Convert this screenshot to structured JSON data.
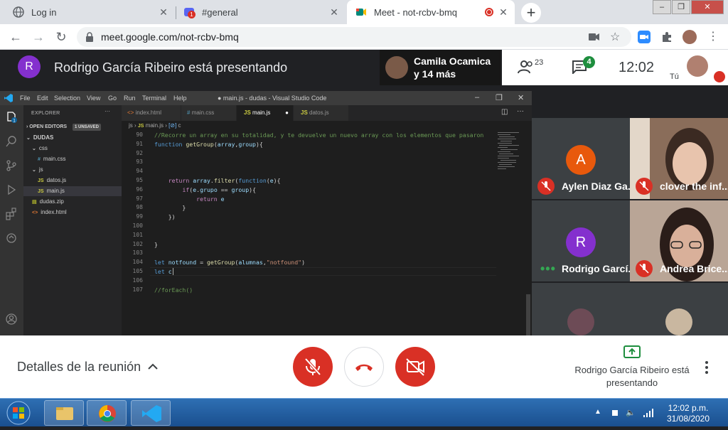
{
  "browser": {
    "tabs": [
      {
        "title": "Log in",
        "icon": "globe-icon"
      },
      {
        "title": "#general",
        "icon": "discord-icon",
        "badge": "1"
      },
      {
        "title": "Meet - not-rcbv-bmq",
        "icon": "meet-icon",
        "recording": true
      }
    ],
    "url": "meet.google.com/not-rcbv-bmq"
  },
  "meet": {
    "presenter_initial": "R",
    "presenting_text": "Rodrigo García Ribeiro está presentando",
    "speaker_name": "Camila Ocamica",
    "speaker_more": "y 14 más",
    "people_count": "23",
    "chat_badge": "4",
    "clock": "12:02",
    "self_label": "Tú",
    "colors": {
      "accent_red": "#d93025",
      "green": "#1e8e3e",
      "dark": "#202124"
    }
  },
  "vscode": {
    "menu": [
      "File",
      "Edit",
      "Selection",
      "View",
      "Go",
      "Run",
      "Terminal",
      "Help"
    ],
    "window_title": "● main.js - dudas - Visual Studio Code",
    "explorer_label": "EXPLORER",
    "open_editors_label": "OPEN EDITORS",
    "unsaved_label": "1 UNSAVED",
    "tree": [
      {
        "label": "DUDAS",
        "indent": 0,
        "type": "folder-open"
      },
      {
        "label": "css",
        "indent": 1,
        "type": "folder-open"
      },
      {
        "label": "main.css",
        "indent": 2,
        "type": "css"
      },
      {
        "label": "js",
        "indent": 1,
        "type": "folder-open"
      },
      {
        "label": "datos.js",
        "indent": 2,
        "type": "js"
      },
      {
        "label": "main.js",
        "indent": 2,
        "type": "js",
        "selected": true
      },
      {
        "label": "dudas.zip",
        "indent": 1,
        "type": "zip"
      },
      {
        "label": "index.html",
        "indent": 1,
        "type": "html"
      }
    ],
    "tabs": [
      {
        "label": "index.html",
        "icon": "<>"
      },
      {
        "label": "main.css",
        "icon": "#"
      },
      {
        "label": "main.js",
        "icon": "JS",
        "active": true,
        "dirty": true
      },
      {
        "label": "datos.js",
        "icon": "JS"
      }
    ],
    "breadcrumb": [
      "js",
      "main.js",
      "c"
    ],
    "lines": [
      {
        "n": "90",
        "text": "//Recorre un array en su totalidad, y te devuelve un nuevo array con los elementos que pasaron"
      },
      {
        "n": "91",
        "text": "function getGroup(array,group){"
      },
      {
        "n": "92",
        "text": ""
      },
      {
        "n": "93",
        "text": ""
      },
      {
        "n": "94",
        "text": ""
      },
      {
        "n": "95",
        "text": "    return array.filter(function(e){"
      },
      {
        "n": "96",
        "text": "        if(e.grupo == group){"
      },
      {
        "n": "97",
        "text": "            return e"
      },
      {
        "n": "98",
        "text": "        }"
      },
      {
        "n": "99",
        "text": "    })"
      },
      {
        "n": "100",
        "text": ""
      },
      {
        "n": "101",
        "text": ""
      },
      {
        "n": "102",
        "text": "}"
      },
      {
        "n": "103",
        "text": ""
      },
      {
        "n": "104",
        "text": "let notfound = getGroup(alumnas,\"notfound\")"
      },
      {
        "n": "105",
        "text": "let c"
      },
      {
        "n": "106",
        "text": ""
      },
      {
        "n": "107",
        "text": "//forEach()"
      }
    ]
  },
  "participants": [
    {
      "name": "Aylen Diaz Ga...",
      "initial": "A",
      "color": "#e8590c",
      "muted": true
    },
    {
      "name": "clover the inf...",
      "video": true,
      "muted": true
    },
    {
      "name": "Rodrigo Garcí...",
      "initial": "R",
      "color": "#8430ce",
      "speaking": true
    },
    {
      "name": "Andrea Brice...",
      "video": true,
      "muted": true
    }
  ],
  "controls": {
    "details_label": "Detalles de la reunión",
    "presenting_label": "Rodrigo García Ribeiro está presentando"
  },
  "taskbar": {
    "time": "12:02 p.m.",
    "date": "31/08/2020"
  }
}
